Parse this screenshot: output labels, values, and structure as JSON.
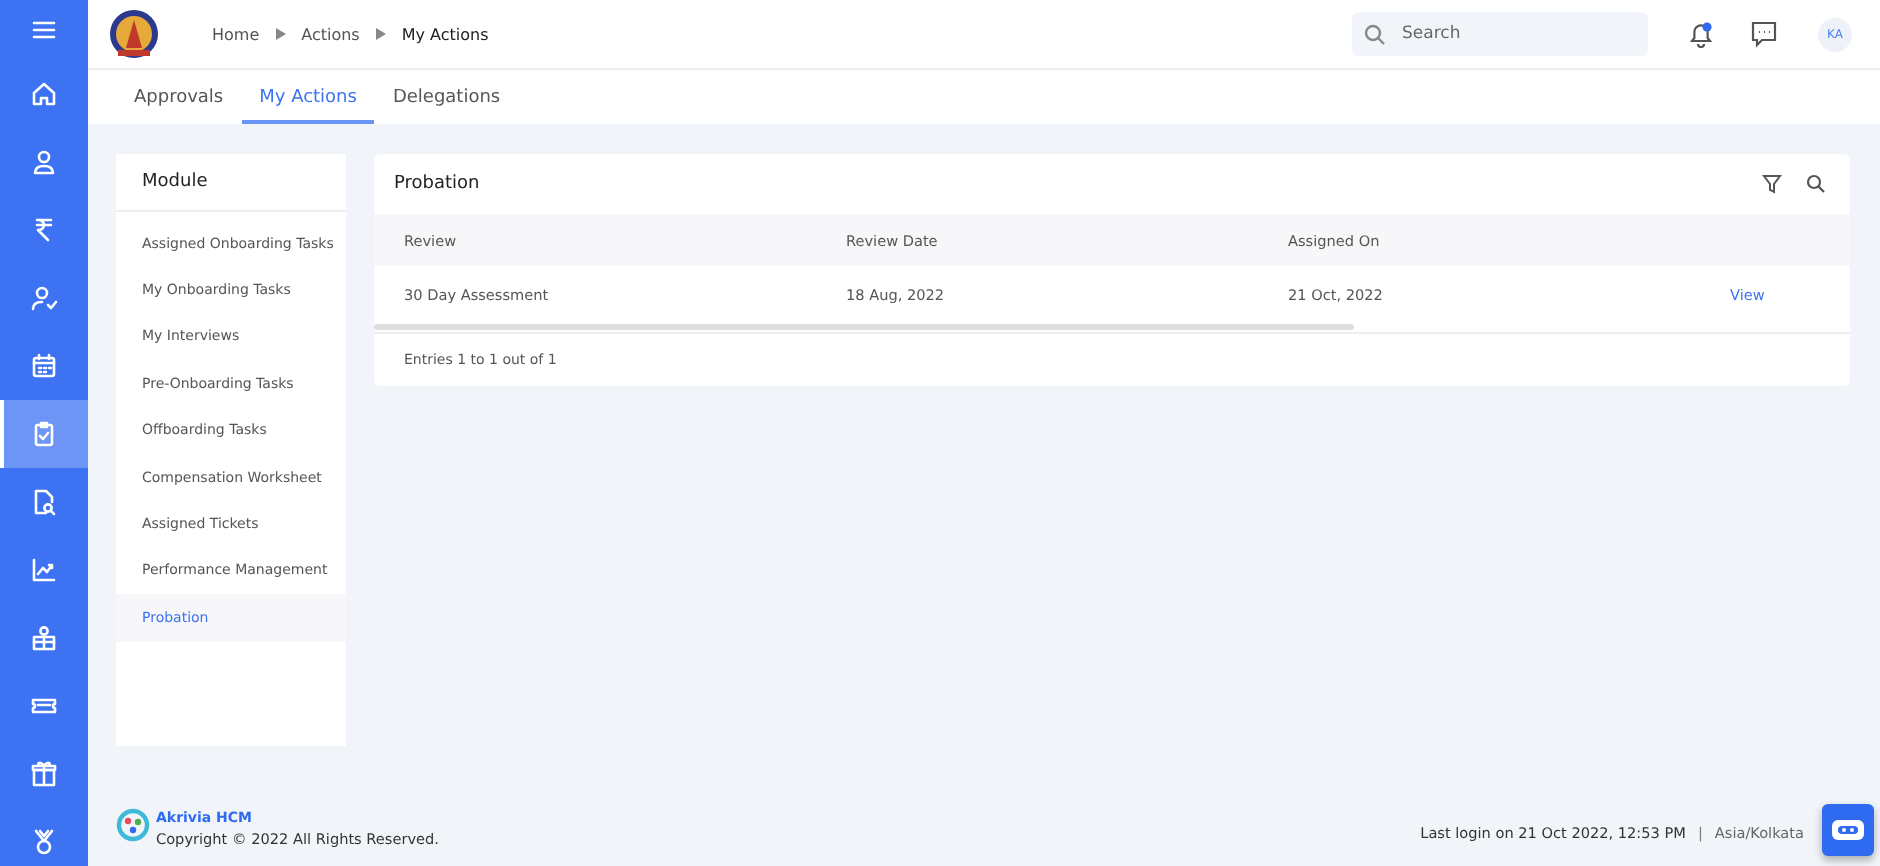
{
  "rail": [
    {
      "selected": false
    },
    {
      "selected": false
    },
    {
      "selected": false
    },
    {
      "selected": false
    },
    {
      "selected": false
    },
    {
      "selected": false
    },
    {
      "selected": true
    },
    {
      "selected": false
    },
    {
      "selected": false
    },
    {
      "selected": false
    },
    {
      "selected": false
    },
    {
      "selected": false
    },
    {
      "selected": false
    }
  ],
  "breadcrumb": [
    "Home",
    "Actions",
    "My Actions"
  ],
  "search": {
    "placeholder": "Search"
  },
  "notification_unread": true,
  "avatar": "KA",
  "tabs": [
    {
      "label": "Approvals",
      "selected": false
    },
    {
      "label": "My Actions",
      "selected": true
    },
    {
      "label": "Delegations",
      "selected": false
    }
  ],
  "module": {
    "title": "Module",
    "items": [
      {
        "label": "Assigned Onboarding Tasks",
        "selected": false
      },
      {
        "label": "My Onboarding Tasks",
        "selected": false
      },
      {
        "label": "My Interviews",
        "selected": false
      },
      {
        "label": "Pre-Onboarding Tasks",
        "selected": false
      },
      {
        "label": "Offboarding Tasks",
        "selected": false
      },
      {
        "label": "Compensation Worksheet",
        "selected": false
      },
      {
        "label": "Assigned Tickets",
        "selected": false
      },
      {
        "label": "Performance Management",
        "selected": false
      },
      {
        "label": "Probation",
        "selected": true
      }
    ]
  },
  "table": {
    "title": "Probation",
    "columns": [
      "Review",
      "Review Date",
      "Assigned On"
    ],
    "rows": [
      {
        "cells": [
          "30 Day Assessment",
          "18 Aug, 2022",
          "21 Oct, 2022"
        ],
        "action": "View"
      }
    ],
    "entries": "Entries 1 to 1 out of 1"
  },
  "footer": {
    "brand": "Akrivia HCM",
    "copyright": "Copyright © 2022 All Rights Reserved.",
    "last_login": "Last login on 21 Oct 2022, 12:53 PM",
    "separator": "|",
    "timezone": "Asia/Kolkata"
  }
}
